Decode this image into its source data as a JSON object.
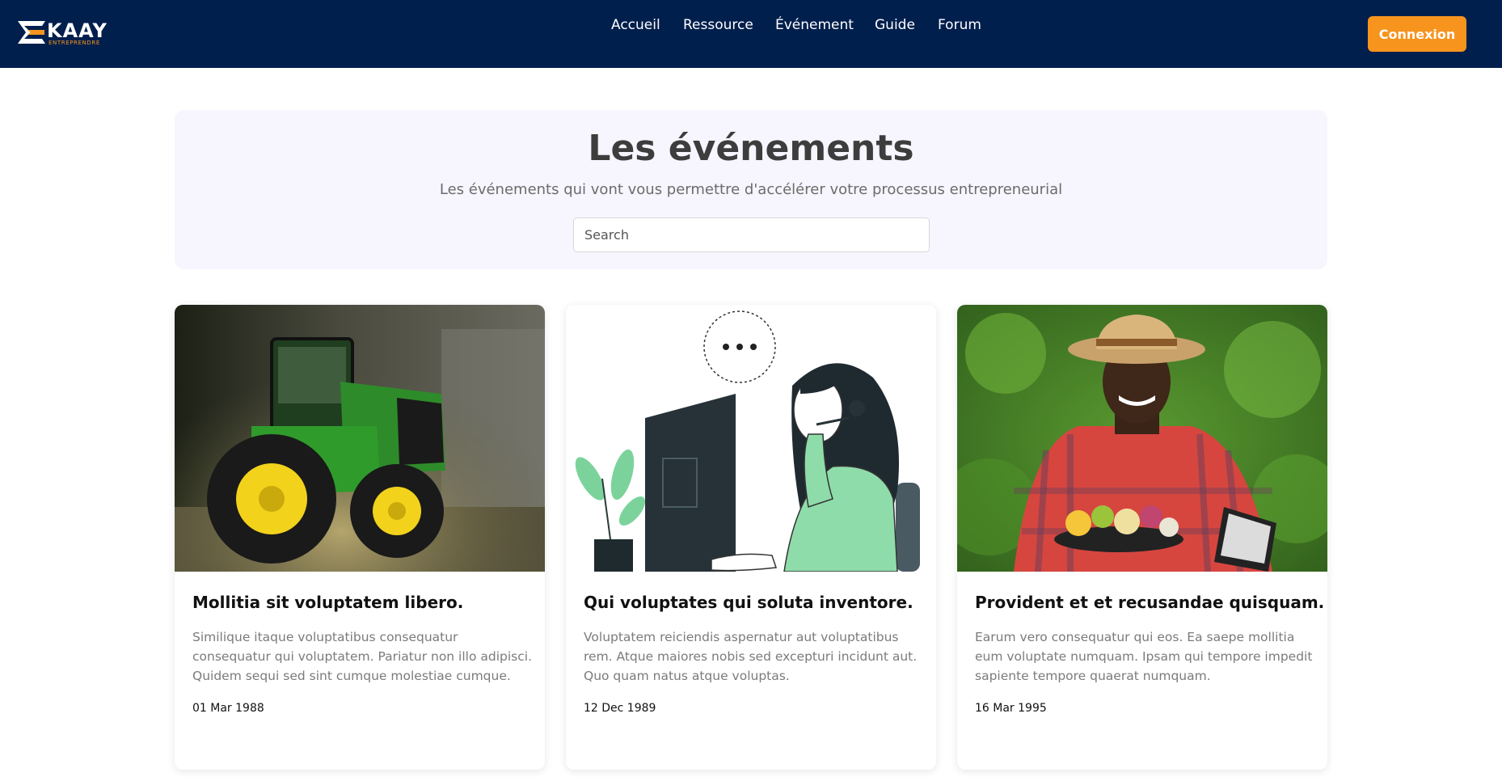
{
  "brand": {
    "name": "KAAY",
    "tagline": "ENTREPRENDRE",
    "colors": {
      "navy": "#001f4d",
      "orange": "#f7941d"
    }
  },
  "nav": {
    "items": [
      {
        "label": "Accueil"
      },
      {
        "label": "Ressource"
      },
      {
        "label": "Événement"
      },
      {
        "label": "Guide"
      },
      {
        "label": "Forum"
      }
    ],
    "login_label": "Connexion"
  },
  "hero": {
    "title": "Les événements",
    "subtitle": "Les événements qui vont vous permettre d'accélérer votre processus entrepreneurial",
    "search_placeholder": "Search"
  },
  "events": [
    {
      "image": "green-tractor-photo",
      "title": "Mollitia sit voluptatem libero.",
      "description": "Similique itaque voluptatibus consequatur consequatur qui voluptatem. Pariatur non illo adipisci. Quidem sequi sed sint cumque molestiae cumque.",
      "date": "01 Mar 1988"
    },
    {
      "image": "support-agent-illustration",
      "title": "Qui voluptates qui soluta inventore.",
      "description": "Voluptatem reiciendis aspernatur aut voluptatibus rem. Atque maiores nobis sed excepturi incidunt aut. Quo quam natus atque voluptas.",
      "date": "12 Dec 1989"
    },
    {
      "image": "farmer-with-vegetables-photo",
      "title": "Provident et et recusandae quisquam.",
      "description": "Earum vero consequatur qui eos. Ea saepe mollitia eum voluptate numquam. Ipsam qui tempore impedit sapiente tempore quaerat numquam.",
      "date": "16 Mar 1995"
    }
  ]
}
